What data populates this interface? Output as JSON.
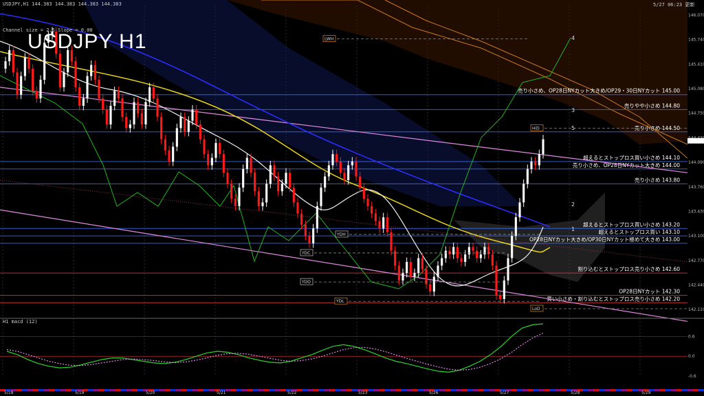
{
  "header": {
    "symbol_info": "USDJPY,H1  144.383 144.383 144.383 144.383",
    "indicator_info": "Channel size = 2.5 Slope = 0.00",
    "timestamp": "5/27 06:23 更新",
    "big_title": "USDJPY H1",
    "macd_label": "H1  macd (12)"
  },
  "colors": {
    "background": "#000000",
    "bull_candle": "#ffffff",
    "bear_candle": "#ff1a1a",
    "grid": "#2a2a2a",
    "level_blue": "#3a6cff",
    "level_red": "#d83a3a",
    "sma_white": "#f2f2f2",
    "sma_yellow": "#e8d31a",
    "sma_blue": "#2c2cff",
    "trend_pink": "#e08ae0",
    "kumo_orange": "#c8781e",
    "chikou_green": "#1fb81f",
    "macd_green": "#2bd42b",
    "signal_pink": "#e08ae0"
  },
  "chart_data": [
    {
      "type": "candlestick",
      "title": "USDJPY H1",
      "ylim": [
        142.0,
        146.2
      ],
      "y_ticks": [
        "146.070",
        "145.740",
        "145.410",
        "145.080",
        "144.750",
        "144.420",
        "144.090",
        "143.760",
        "143.430",
        "143.100",
        "142.770",
        "142.440",
        "142.110"
      ],
      "x_tick_labels": [
        "5/18",
        "5/19",
        "5/20",
        "5/21",
        "5/22",
        "5/23",
        "5/26",
        "5/27",
        "5/28",
        "5/29"
      ],
      "closes": [
        145.45,
        145.6,
        145.3,
        145.0,
        145.25,
        145.5,
        145.35,
        145.05,
        144.95,
        145.2,
        145.7,
        145.8,
        145.85,
        145.55,
        145.1,
        145.3,
        145.6,
        145.45,
        145.1,
        144.85,
        144.95,
        145.25,
        145.4,
        145.2,
        144.95,
        144.8,
        144.6,
        144.85,
        145.05,
        144.95,
        144.7,
        144.55,
        144.6,
        144.9,
        144.75,
        144.6,
        144.9,
        145.1,
        144.95,
        144.7,
        144.4,
        144.25,
        144.1,
        144.3,
        144.55,
        144.7,
        144.5,
        144.65,
        144.8,
        144.6,
        144.4,
        144.2,
        144.05,
        144.15,
        144.35,
        144.2,
        143.95,
        143.8,
        143.6,
        143.5,
        143.75,
        144.0,
        144.15,
        143.95,
        143.7,
        143.5,
        143.55,
        143.8,
        144.05,
        143.9,
        143.7,
        143.8,
        143.95,
        143.75,
        143.55,
        143.4,
        143.25,
        143.1,
        143.0,
        143.2,
        143.5,
        143.75,
        143.9,
        144.05,
        144.2,
        144.1,
        143.95,
        143.85,
        144.05,
        144.1,
        143.9,
        143.75,
        143.6,
        143.5,
        143.4,
        143.3,
        143.2,
        143.35,
        143.15,
        142.9,
        142.7,
        142.5,
        142.6,
        142.75,
        142.55,
        142.6,
        142.8,
        142.65,
        142.45,
        142.35,
        142.55,
        142.7,
        142.8,
        142.9,
        142.85,
        142.95,
        142.8,
        142.75,
        142.85,
        142.95,
        142.9,
        142.8,
        142.85,
        142.95,
        142.85,
        142.7,
        142.3,
        142.25,
        142.5,
        142.8,
        143.1,
        143.35,
        143.55,
        143.8,
        144.0,
        144.1,
        144.05,
        144.2,
        144.4
      ],
      "horizontal_levels": [
        {
          "price": 145.0,
          "label": "売り小さめ、OP28日NYカット大きめ/OP29・30日NYカット 145.00",
          "color": "#3a6cff"
        },
        {
          "price": 144.8,
          "label": "売りやや小さめ 144.80",
          "color": "#3a6cff"
        },
        {
          "price": 144.5,
          "label": "売り小さめ 144.50",
          "color": "#3a6cff"
        },
        {
          "price": 144.1,
          "label": "超えるとストップロス買い小さめ 144.10",
          "color": "#3a6cff"
        },
        {
          "price": 144.0,
          "label": "売り小さめ、OP28日NYカット大きめ 144.00",
          "color": "#3a6cff"
        },
        {
          "price": 143.8,
          "label": "売り小さめ 143.80",
          "color": "#3a6cff"
        },
        {
          "price": 143.2,
          "label": "超えるとストップロス買い小さめ 143.20",
          "color": "#3a6cff"
        },
        {
          "price": 143.1,
          "label": "超えるとストップロス買い 143.10",
          "color": "#3a6cff"
        },
        {
          "price": 143.0,
          "label": "OP28日NYカット大きめ/OP30日NYカット極めて大きめ 143.00",
          "color": "#3a6cff"
        },
        {
          "price": 142.6,
          "label": "割り込むとストップロス売り小さめ 142.60",
          "color": "#d83a3a"
        },
        {
          "price": 142.3,
          "label": "OP28日NYカット 142.30",
          "color": "#d83a3a"
        },
        {
          "price": 142.2,
          "label": "買い小さめ・割り込むとストップロス売り小さめ 142.20",
          "color": "#d83a3a"
        }
      ],
      "markers": [
        {
          "label": "LWH",
          "price": 145.75
        },
        {
          "label": "YDH",
          "price": 143.12
        },
        {
          "label": "YDC",
          "price": 142.87
        },
        {
          "label": "YDO",
          "price": 142.48
        },
        {
          "label": "YDL",
          "price": 142.22
        },
        {
          "label": "HiD",
          "price": 144.55
        },
        {
          "label": "LoD",
          "price": 142.12
        }
      ],
      "wave_labels": [
        "4",
        "3",
        "5",
        "2",
        "1"
      ]
    },
    {
      "type": "line",
      "title": "H1  macd (12)",
      "y_ticks": [
        "0.6",
        "0.0",
        "-0.6"
      ],
      "series": [
        {
          "values": [
            0.15,
            0.05,
            -0.1,
            -0.22,
            -0.3,
            -0.35,
            -0.33,
            -0.26,
            -0.18,
            -0.1,
            -0.05,
            -0.05,
            -0.1,
            -0.15,
            -0.2,
            -0.22,
            -0.18,
            -0.1,
            0.0,
            0.1,
            0.15,
            0.12,
            0.05,
            -0.05,
            -0.12,
            -0.18,
            -0.2,
            -0.15,
            -0.05,
            0.05,
            0.18,
            0.3,
            0.35,
            0.3,
            0.2,
            0.08,
            -0.05,
            -0.15,
            -0.22,
            -0.3,
            -0.38,
            -0.45,
            -0.48,
            -0.42,
            -0.3,
            -0.15,
            0.05,
            0.3,
            0.6,
            0.85,
            0.95,
            0.98
          ]
        },
        {
          "values": [
            0.2,
            0.15,
            0.05,
            -0.05,
            -0.15,
            -0.22,
            -0.27,
            -0.28,
            -0.25,
            -0.2,
            -0.15,
            -0.1,
            -0.08,
            -0.1,
            -0.13,
            -0.17,
            -0.19,
            -0.17,
            -0.12,
            -0.05,
            0.03,
            0.08,
            0.09,
            0.06,
            0.0,
            -0.06,
            -0.12,
            -0.15,
            -0.13,
            -0.08,
            0.0,
            0.1,
            0.2,
            0.26,
            0.27,
            0.22,
            0.14,
            0.04,
            -0.06,
            -0.15,
            -0.24,
            -0.32,
            -0.39,
            -0.42,
            -0.4,
            -0.33,
            -0.22,
            -0.07,
            0.12,
            0.35,
            0.55,
            0.7
          ]
        }
      ]
    }
  ]
}
